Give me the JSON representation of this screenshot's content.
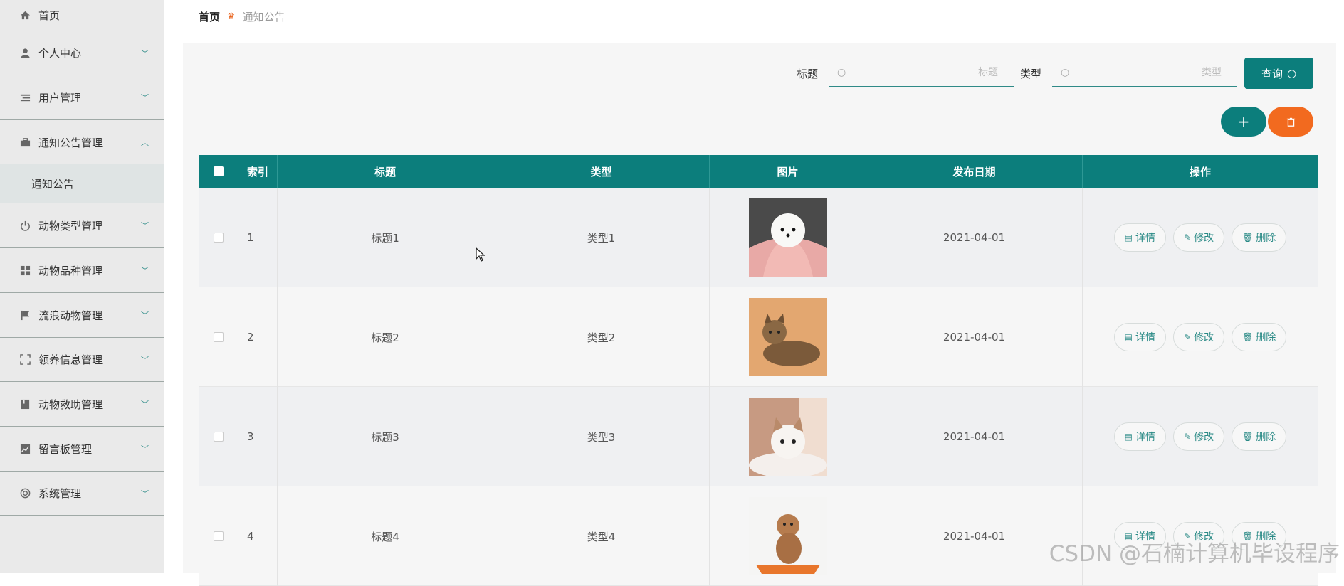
{
  "sidebar": {
    "items": [
      {
        "label": "首页",
        "icon": "home-icon"
      },
      {
        "label": "个人中心",
        "icon": "user-icon"
      },
      {
        "label": "用户管理",
        "icon": "list-icon"
      },
      {
        "label": "通知公告管理",
        "icon": "briefcase-icon"
      },
      {
        "label": "动物类型管理",
        "icon": "power-icon"
      },
      {
        "label": "动物品种管理",
        "icon": "grid-icon"
      },
      {
        "label": "流浪动物管理",
        "icon": "flag-icon"
      },
      {
        "label": "领养信息管理",
        "icon": "scan-icon"
      },
      {
        "label": "动物救助管理",
        "icon": "book-icon"
      },
      {
        "label": "留言板管理",
        "icon": "chart-icon"
      },
      {
        "label": "系统管理",
        "icon": "lifebuoy-icon"
      }
    ],
    "sub_item": "通知公告"
  },
  "breadcrumb": {
    "home": "首页",
    "current": "通知公告"
  },
  "search": {
    "title_label": "标题",
    "title_placeholder": "标题",
    "type_label": "类型",
    "type_placeholder": "类型",
    "query_button": "查询"
  },
  "actions": {
    "add": "+",
    "delete_icon": "trash-icon"
  },
  "table": {
    "headers": [
      "索引",
      "标题",
      "类型",
      "图片",
      "发布日期",
      "操作"
    ],
    "rows": [
      {
        "index": "1",
        "title": "标题1",
        "type": "类型1",
        "date": "2021-04-01",
        "image": "white-dog"
      },
      {
        "index": "2",
        "title": "标题2",
        "type": "类型2",
        "date": "2021-04-01",
        "image": "tabby-cat"
      },
      {
        "index": "3",
        "title": "标题3",
        "type": "类型3",
        "date": "2021-04-01",
        "image": "kitten"
      },
      {
        "index": "4",
        "title": "标题4",
        "type": "类型4",
        "date": "2021-04-01",
        "image": "poodle"
      }
    ],
    "ops": {
      "detail": "详情",
      "edit": "修改",
      "delete": "删除"
    }
  },
  "watermark": "CSDN @石楠计算机毕设程序",
  "colors": {
    "accent": "#0c7e7c",
    "danger": "#f26a1f"
  }
}
